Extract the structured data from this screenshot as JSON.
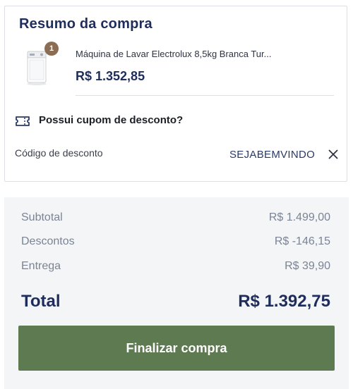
{
  "summary_card": {
    "title": "Resumo da compra",
    "product": {
      "quantity_badge": "1",
      "name": "Máquina de Lavar Electrolux 8,5kg Branca Tur...",
      "price": "R$ 1.352,85",
      "image_icon": "washing-machine-icon"
    },
    "coupon": {
      "icon": "ticket-icon",
      "question": "Possui cupom de desconto?",
      "code_label": "Código de desconto",
      "code_value": "SEJABEMVINDO",
      "remove_icon": "close-icon"
    }
  },
  "totals": {
    "subtotal_label": "Subtotal",
    "subtotal_value": "R$ 1.499,00",
    "discounts_label": "Descontos",
    "discounts_value": "R$ -146,15",
    "delivery_label": "Entrega",
    "delivery_value": "R$ 39,90",
    "total_label": "Total",
    "total_value": "R$ 1.392,75"
  },
  "actions": {
    "finish_label": "Finalizar compra"
  },
  "colors": {
    "brand_navy": "#1f2d5a",
    "button_green": "#5e7a50",
    "badge_brown": "#8a6d52",
    "summary_bg": "#f4f5f7"
  }
}
